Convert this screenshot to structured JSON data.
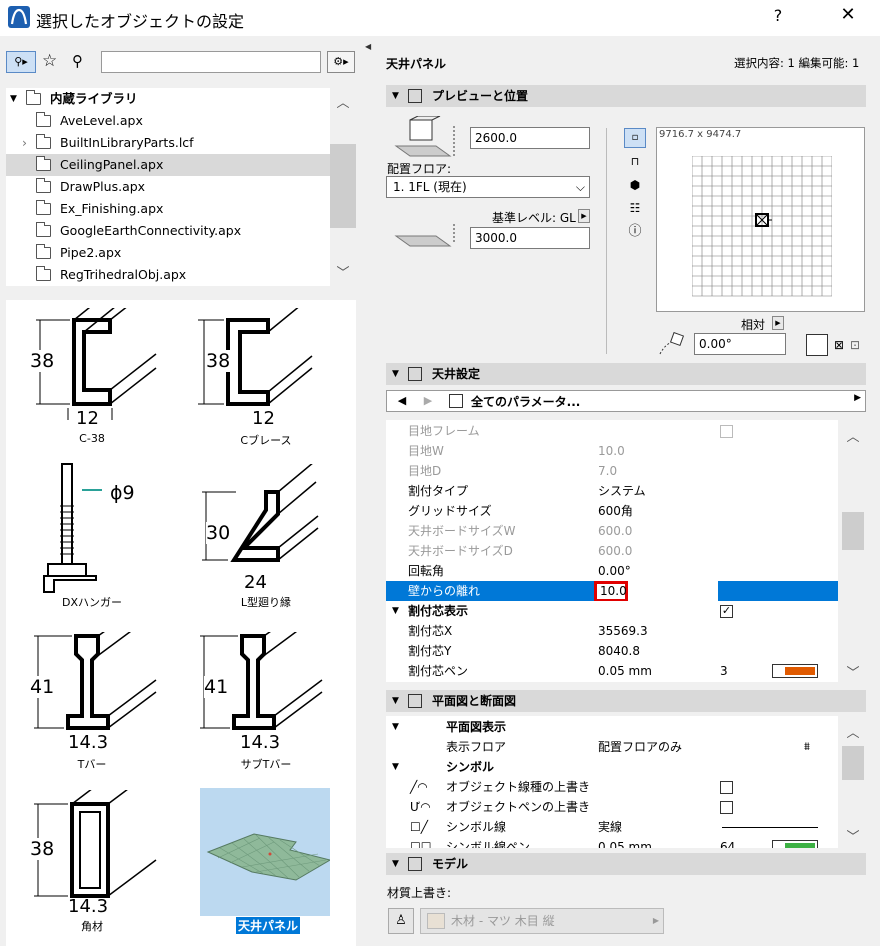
{
  "window": {
    "title": "選択したオブジェクトの設定",
    "help": "?",
    "close": "✕"
  },
  "library": {
    "root": "内蔵ライブラリ",
    "items": [
      "AveLevel.apx",
      "BuiltInLibraryParts.lcf",
      "CeilingPanel.apx",
      "DrawPlus.apx",
      "Ex_Finishing.apx",
      "GoogleEarthConnectivity.apx",
      "Pipe2.apx",
      "RegTrihedralObj.apx"
    ],
    "selected": "CeilingPanel.apx",
    "search_value": ""
  },
  "thumbnails": [
    {
      "label": "C-38",
      "dims": [
        "38",
        "12"
      ]
    },
    {
      "label": "Cブレース",
      "dims": [
        "38",
        "12"
      ]
    },
    {
      "label": "DXハンガー",
      "dims": [
        "ϕ9"
      ]
    },
    {
      "label": "L型廻り縁",
      "dims": [
        "30",
        "24"
      ]
    },
    {
      "label": "Tバー",
      "dims": [
        "41",
        "14.3"
      ]
    },
    {
      "label": "サブTバー",
      "dims": [
        "41",
        "14.3"
      ]
    },
    {
      "label": "角材",
      "dims": [
        "38",
        "14.3"
      ]
    },
    {
      "label": "天井パネル",
      "dims": []
    }
  ],
  "header": {
    "name": "天井パネル",
    "selection": "選択内容: 1 編集可能: 1"
  },
  "preview": {
    "section": "プレビューと位置",
    "top_offset": "2600.0",
    "floor_label": "配置フロア:",
    "floor_value": "1. 1FL (現在)",
    "ref_label": "基準レベル: GL",
    "ref_offset": "3000.0",
    "size_text": "9716.7 x 9474.7",
    "relative": "相対",
    "angle": "0.00°"
  },
  "ceiling": {
    "section": "天井設定",
    "param_nav": "全てのパラメータ...",
    "rows": [
      {
        "n": "目地フレーム",
        "v": "",
        "dim": true
      },
      {
        "n": "目地W",
        "v": "10.0",
        "dim": true
      },
      {
        "n": "目地D",
        "v": "7.0",
        "dim": true
      },
      {
        "n": "割付タイプ",
        "v": "システム",
        "dim": false
      },
      {
        "n": "グリッドサイズ",
        "v": "600角",
        "dim": false
      },
      {
        "n": "天井ボードサイズW",
        "v": "600.0",
        "dim": true
      },
      {
        "n": "天井ボードサイズD",
        "v": "600.0",
        "dim": true
      },
      {
        "n": "回転角",
        "v": "0.00°",
        "dim": false
      },
      {
        "n": "壁からの離れ",
        "v": "10.0",
        "dim": false
      },
      {
        "n": "割付芯表示",
        "v": "",
        "dim": false
      },
      {
        "n": "割付芯X",
        "v": "35569.3",
        "dim": false
      },
      {
        "n": "割付芯Y",
        "v": "8040.8",
        "dim": false
      },
      {
        "n": "割付芯ペン",
        "v": "0.05 mm",
        "dim": false
      }
    ],
    "pen_number": "3",
    "pen_color": "#e05a00"
  },
  "plan": {
    "section": "平面図と断面図",
    "rows": [
      {
        "n": "平面図表示",
        "v": ""
      },
      {
        "n": "表示フロア",
        "v": "配置フロアのみ"
      },
      {
        "n": "シンボル",
        "v": ""
      },
      {
        "n": "オブジェクト線種の上書き",
        "v": ""
      },
      {
        "n": "オブジェクトペンの上書き",
        "v": ""
      },
      {
        "n": "シンボル線",
        "v": "実線"
      },
      {
        "n": "シンボル線ペン",
        "v": "0.05 mm"
      }
    ],
    "pen_number": "64",
    "pen_color": "#3cb043"
  },
  "model": {
    "section": "モデル",
    "material_label": "材質上書き:",
    "material_value": "木材 - マツ 木目 縦"
  }
}
